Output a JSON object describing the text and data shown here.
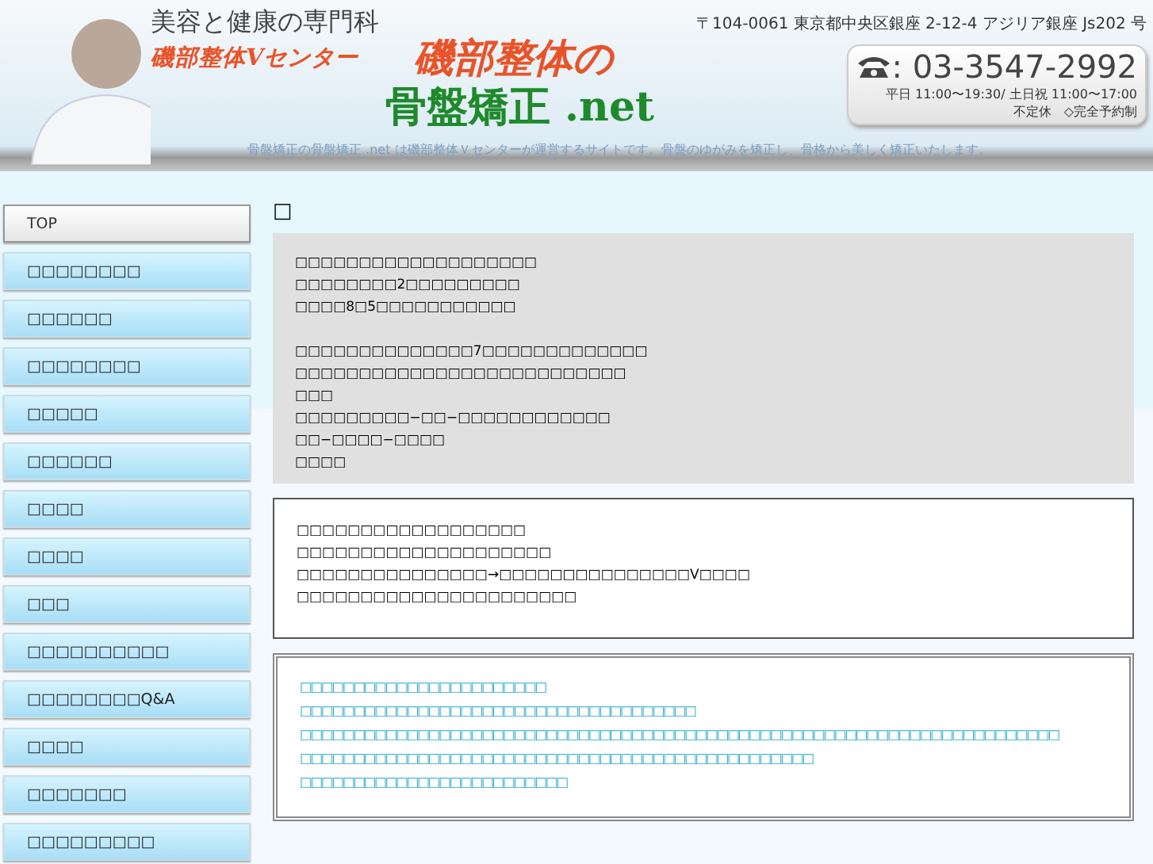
{
  "header": {
    "tagline": "美容と健康の専門科",
    "clinic": "磯部整体Vセンター",
    "logo_line_1": "磯部整体の",
    "logo_line_2": "骨盤矯正 .net",
    "address": "〒104-0061 東京都中央区銀座 2-12-4 アジリア銀座 Js202 号",
    "phone": ": 03-3547-2992",
    "hours": "平日 11:00〜19:30/ 土日祝 11:00〜17:00",
    "note": "不定休　◇完全予約制",
    "caption": "骨盤矯正の骨盤矯正 .net は磯部整体Ｖセンターが運営するサイトです。骨盤のゆがみを矯正し、骨格から美しく矯正いたします。"
  },
  "sidebar": {
    "items": [
      {
        "label": "TOP",
        "selected": true
      },
      {
        "label": "□□□□□□□□",
        "selected": false
      },
      {
        "label": "□□□□□□",
        "selected": false
      },
      {
        "label": "□□□□□□□□",
        "selected": false
      },
      {
        "label": "□□□□□",
        "selected": false
      },
      {
        "label": "□□□□□□",
        "selected": false
      },
      {
        "label": "□□□□",
        "selected": false
      },
      {
        "label": "□□□□",
        "selected": false
      },
      {
        "label": "□□□",
        "selected": false
      },
      {
        "label": "□□□□□□□□□□",
        "selected": false
      },
      {
        "label": "□□□□□□□□Q&A",
        "selected": false
      },
      {
        "label": "□□□□",
        "selected": false
      },
      {
        "label": "□□□□□□□",
        "selected": false
      },
      {
        "label": "□□□□□□□□□",
        "selected": false
      }
    ]
  },
  "content": {
    "title": "□",
    "boxes": [
      {
        "kind": "gray",
        "paragraphs": [
          [
            "□□□□□□□□□□□□□□□□□□□",
            "□□□□□□□□2□□□□□□□□□",
            "□□□□8□5□□□□□□□□□□□"
          ],
          [
            "□□□□□□□□□□□□□□7□□□□□□□□□□□□□",
            "□□□□□□□□□□□□□□□□□□□□□□□□□□",
            "□□□",
            "□□□□□□□□□−□□−□□□□□□□□□□□□",
            "□□−□□□□−□□□□",
            "□□□□"
          ]
        ]
      },
      {
        "kind": "plain",
        "paragraphs": [
          [
            "□□□□□□□□□□□□□□□□□□",
            "□□□□□□□□□□□□□□□□□□□□",
            "□□□□□□□□□□□□□□□→□□□□□□□□□□□□□□□V□□□□",
            "□□□□□□□□□□□□□□□□□□□□□□"
          ]
        ]
      },
      {
        "kind": "links",
        "paragraphs": [
          [
            "□□□□□□□□□□□□□□□□□□□□□□□",
            "□□□□□□□□□□□□□□□□□□□□□□□□□□□□□□□□□□□□□",
            "□□□□□□□□□□□□□□□□□□□□□□□□□□□□□□□□□□□□□□□□□□□□□□□□□□□□□□□□□□□□□□□□□□□□□□□",
            "□□□□□□□□□□□□□□□□□□□□□□□□□□□□□□□□□□□□□□□□□□□□□□□□",
            "□□□□□□□□□□□□□□□□□□□□□□□□□"
          ]
        ]
      }
    ]
  }
}
